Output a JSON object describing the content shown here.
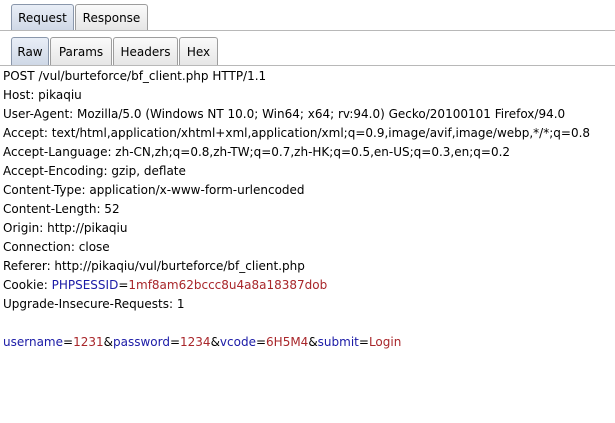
{
  "tabs_top": [
    "Request",
    "Response"
  ],
  "tabs_sub": [
    "Raw",
    "Params",
    "Headers",
    "Hex"
  ],
  "request": {
    "request_line": "POST /vul/burteforce/bf_client.php HTTP/1.1",
    "headers": [
      "Host: pikaqiu",
      "User-Agent: Mozilla/5.0 (Windows NT 10.0; Win64; x64; rv:94.0) Gecko/20100101 Firefox/94.0",
      "Accept: text/html,application/xhtml+xml,application/xml;q=0.9,image/avif,image/webp,*/*;q=0.8",
      "Accept-Language: zh-CN,zh;q=0.8,zh-TW;q=0.7,zh-HK;q=0.5,en-US;q=0.3,en;q=0.2",
      "Accept-Encoding: gzip, deflate",
      "Content-Type: application/x-www-form-urlencoded",
      "Content-Length: 52",
      "Origin: http://pikaqiu",
      "Connection: close",
      "Referer: http://pikaqiu/vul/burteforce/bf_client.php"
    ],
    "cookie": {
      "prefix": "Cookie: ",
      "name": "PHPSESSID",
      "eq": "=",
      "value": "1mf8am62bccc8u4a8a18387dob"
    },
    "upgrade": "Upgrade-Insecure-Requests: 1",
    "body": {
      "username_key": "username",
      "eq1": "=",
      "username_val": "1231",
      "amp1": "&",
      "password_key": "password",
      "eq2": "=",
      "password_val": "1234",
      "amp2": "&",
      "vcode_key": "vcode",
      "eq3": "=",
      "vcode_val": "6H5M4",
      "amp3": "&",
      "submit_key": "submit",
      "eq4": "=",
      "submit_val": "Login"
    }
  },
  "colors": {
    "param_name": "#1a1aa6",
    "param_value": "#a8262a"
  }
}
